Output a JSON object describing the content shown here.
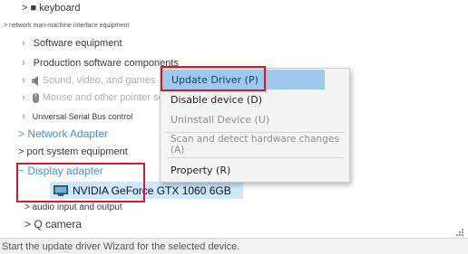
{
  "tree": {
    "keyboard": "> ■ keyboard",
    "network_hmi": "> network man-machine interface equipment",
    "software_equipment": "Software equipment",
    "production_software": "Production software components",
    "sound_video_games": "Sound, video, and games",
    "mouse_pointers": "Mouse and other pointer se",
    "usb_controller": "Universal Serial Bus control",
    "network_adapter": "> Network Adapter",
    "port_system": "> port system equipment",
    "display_adapter": "~ Display adapter",
    "nvidia_device": "NVIDIA GeForce GTX 1060 6GB",
    "audio_io": "> audio input and output",
    "camera": "> Q camera"
  },
  "context_menu": {
    "update_driver": "Update Driver (P)",
    "disable_device": "Disable device (D)",
    "uninstall_device": "Uninstall Device (U)",
    "scan_hardware": "Scan and detect hardware changes (A)",
    "property": "Property (R)"
  },
  "status_bar": {
    "text": "Start the update driver Wizard for the selected device."
  },
  "colors": {
    "highlight": "#9dc9ef",
    "selection": "#cce8ff",
    "annotation_red": "#d7192c",
    "link_blue": "#4a8fd6"
  }
}
